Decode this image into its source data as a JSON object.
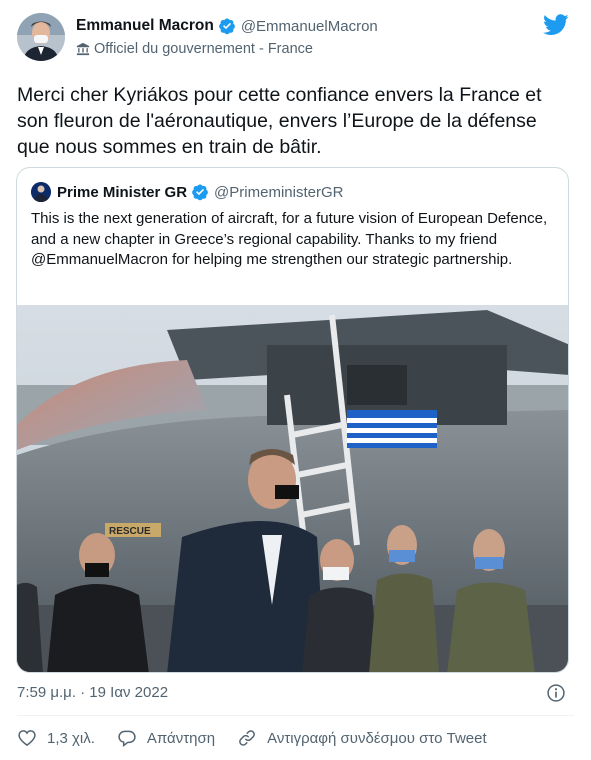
{
  "author": {
    "display_name": "Emmanuel Macron",
    "handle": "@EmmanuelMacron",
    "label": "Officiel du gouvernement - France"
  },
  "tweet": {
    "text": "Merci cher Kyriákos pour cette confiance envers la France et son fleuron de l'aéronautique, envers l’Europe de la défense que nous sommes en train de bâtir."
  },
  "quoted": {
    "display_name": "Prime Minister GR",
    "handle": "@PrimeministerGR",
    "text": "This is the next generation of aircraft, for a future vision of European Defence, and a new chapter in Greece’s regional capability. Thanks to my friend @EmmanuelMacron for helping me strengthen our strategic partnership.",
    "photo_text": "RESCUE"
  },
  "meta": {
    "timestamp": "7:59 μ.μ. · 19 Ιαν 2022"
  },
  "actions": {
    "like_count": "1,3 χιλ.",
    "reply_label": "Απάντηση",
    "copy_link_label": "Αντιγραφή συνδέσμου στο Tweet"
  },
  "colors": {
    "twitter_blue": "#1d9bf0",
    "text_primary": "#0f1419",
    "text_secondary": "#536471",
    "border": "#cfd9de"
  },
  "icons": [
    "verified-icon",
    "government-label-icon",
    "twitter-logo-icon",
    "info-icon",
    "heart-icon",
    "reply-icon",
    "link-icon"
  ]
}
